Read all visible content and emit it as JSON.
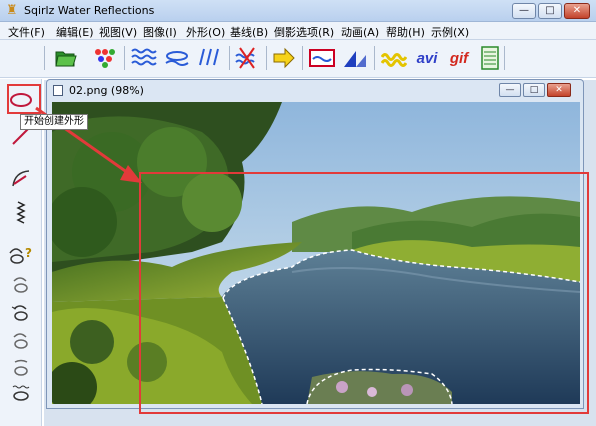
{
  "window": {
    "title": "Sqirlz Water Reflections",
    "controls": {
      "minimize": "—",
      "maximize": "□",
      "close": "✕"
    }
  },
  "menu": [
    "文件(F)",
    "编辑(E)",
    "视图(V)",
    "图像(I)",
    "外形(O)",
    "基线(B)",
    "倒影选项(R)",
    "动画(A)",
    "帮助(H)",
    "示例(X)"
  ],
  "toolbar": {
    "avi_label": "avi",
    "gif_label": "gif"
  },
  "tooltip": "开始创建外形",
  "child_window": {
    "title": "02.png  (98%)",
    "controls": {
      "minimize": "—",
      "maximize": "□",
      "close": "✕"
    }
  },
  "colors": {
    "highlight_red": "#e23a3a",
    "titlebar": "#c4d8f1",
    "water": "#27486b",
    "sky": "#b9d4ec",
    "grass": "#7a9a2a"
  }
}
